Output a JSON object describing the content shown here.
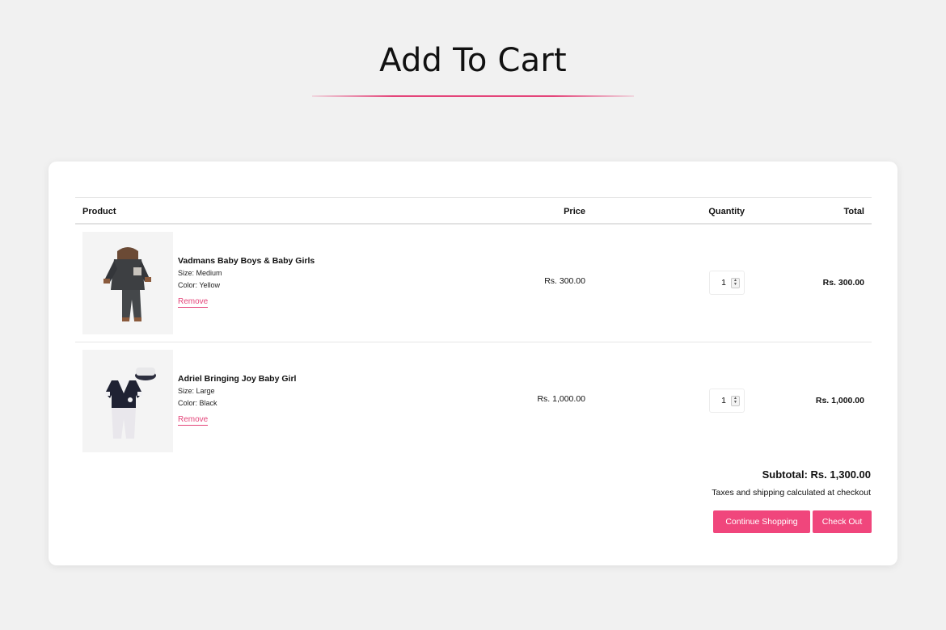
{
  "page": {
    "title": "Add To Cart"
  },
  "table": {
    "headers": {
      "product": "Product",
      "price": "Price",
      "quantity": "Quantity",
      "total": "Total"
    },
    "items": [
      {
        "name": "Vadmans Baby Boys & Baby Girls",
        "size": "Size: Medium",
        "color": "Color: Yellow",
        "remove": "Remove",
        "price": "Rs. 300.00",
        "quantity": "1",
        "total": "Rs. 300.00",
        "image_icon": "hoodie-set-icon"
      },
      {
        "name": "Adriel Bringing Joy Baby Girl",
        "size": "Size: Large",
        "color": "Color: Black",
        "remove": "Remove",
        "price": "Rs. 1,000.00",
        "quantity": "1",
        "total": "Rs. 1,000.00",
        "image_icon": "sailor-romper-icon"
      }
    ]
  },
  "summary": {
    "subtotal": "Subtotal: Rs. 1,300.00",
    "note": "Taxes and shipping calculated at checkout",
    "continue_label": "Continue Shopping",
    "checkout_label": "Check Out"
  },
  "colors": {
    "accent": "#f0467c",
    "background": "#f1f1f1",
    "card": "#ffffff"
  }
}
